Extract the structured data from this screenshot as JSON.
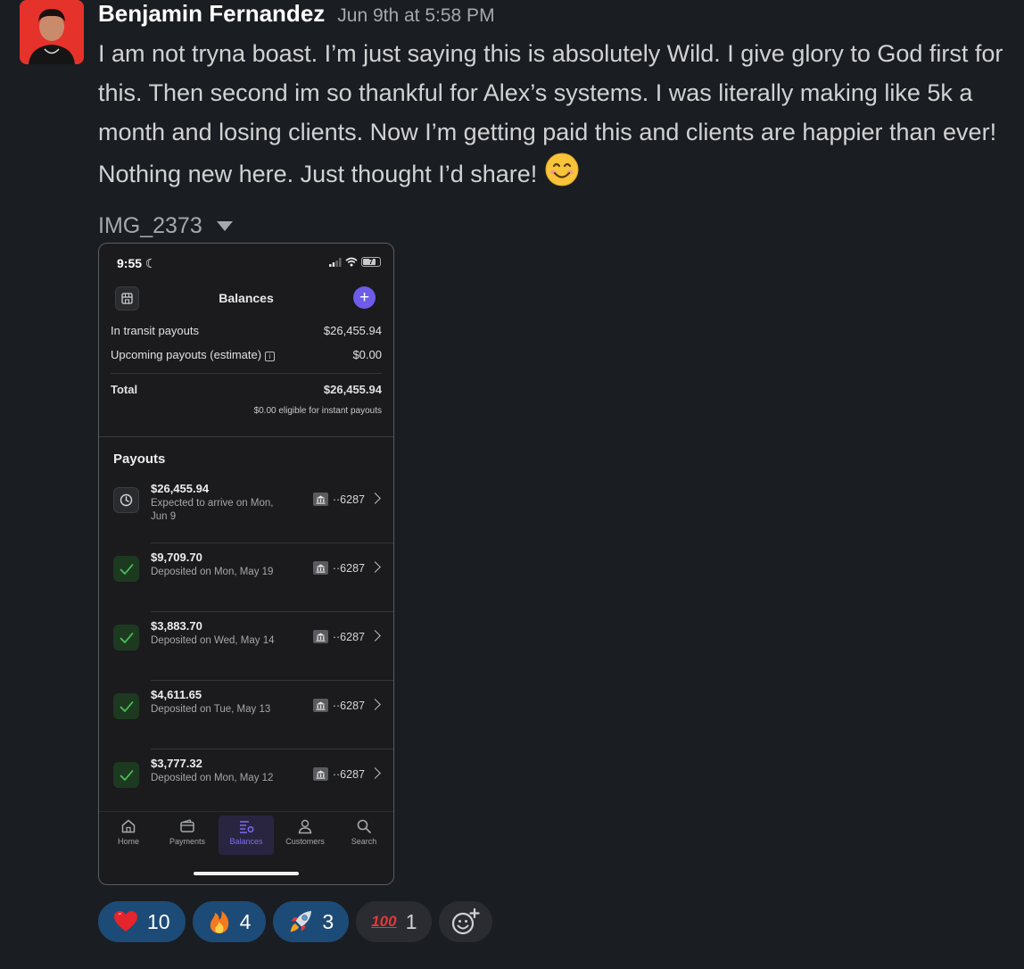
{
  "message": {
    "author": "Benjamin Fernandez",
    "timestamp": "Jun 9th at 5:58 PM",
    "text": "I am not tryna boast. I’m just saying this is absolutely Wild. I give glory to God first for this. Then second im so thankful for Alex’s systems. I was literally making like 5k a month and losing clients. Now I’m getting paid this and clients are happier than ever! Nothing new here. Just thought I’d share!",
    "emoji": "smiling-face-emoji",
    "attachment_name": "IMG_2373"
  },
  "phone": {
    "status_time": "9:55",
    "battery": "7",
    "title": "Balances",
    "in_transit_label": "In transit payouts",
    "in_transit_value": "$26,455.94",
    "upcoming_label": "Upcoming payouts (estimate)",
    "upcoming_value": "$0.00",
    "total_label": "Total",
    "total_value": "$26,455.94",
    "eligible_note": "$0.00 eligible for instant payouts",
    "payouts_title": "Payouts",
    "payouts": [
      {
        "amount": "$26,455.94",
        "desc": "Expected to arrive on Mon, Jun 9",
        "account": "··6287",
        "status": "pending"
      },
      {
        "amount": "$9,709.70",
        "desc": "Deposited on Mon, May 19",
        "account": "··6287",
        "status": "done"
      },
      {
        "amount": "$3,883.70",
        "desc": "Deposited on Wed, May 14",
        "account": "··6287",
        "status": "done"
      },
      {
        "amount": "$4,611.65",
        "desc": "Deposited on Tue, May 13",
        "account": "··6287",
        "status": "done"
      },
      {
        "amount": "$3,777.32",
        "desc": "Deposited on Mon, May 12",
        "account": "··6287",
        "status": "done"
      }
    ],
    "tabs": [
      {
        "label": "Home",
        "icon": "home-icon"
      },
      {
        "label": "Payments",
        "icon": "wallet-icon"
      },
      {
        "label": "Balances",
        "icon": "balances-icon",
        "active": true
      },
      {
        "label": "Customers",
        "icon": "person-icon"
      },
      {
        "label": "Search",
        "icon": "search-icon"
      }
    ],
    "accent": "#6e5ce8"
  },
  "reactions": [
    {
      "emoji": "red-heart",
      "count": "10",
      "highlighted": true
    },
    {
      "emoji": "fire",
      "count": "4",
      "highlighted": true
    },
    {
      "emoji": "rocket",
      "count": "3",
      "highlighted": true
    },
    {
      "emoji": "hundred-points",
      "glyph": "100",
      "count": "1",
      "highlighted": false
    }
  ],
  "colors": {
    "background": "#1a1d21",
    "reaction_highlight": "#1d4b77",
    "check_green": "#4cc25a"
  }
}
